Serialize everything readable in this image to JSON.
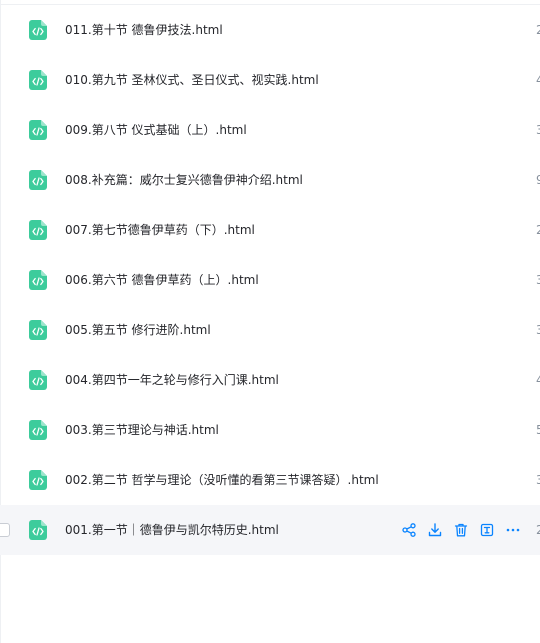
{
  "files": [
    {
      "name": "011.第十节 德鲁伊技法.html",
      "meta": "2"
    },
    {
      "name": "010.第九节 圣林仪式、圣日仪式、视实践.html",
      "meta": "4"
    },
    {
      "name": "009.第八节 仪式基础（上）.html",
      "meta": "3"
    },
    {
      "name": "008.补充篇：威尔士复兴德鲁伊神介绍.html",
      "meta": "9"
    },
    {
      "name": "007.第七节德鲁伊草药（下）.html",
      "meta": "2"
    },
    {
      "name": "006.第六节 德鲁伊草药（上）.html",
      "meta": "3"
    },
    {
      "name": "005.第五节 修行进阶.html",
      "meta": "3"
    },
    {
      "name": "004.第四节一年之轮与修行入门课.html",
      "meta": "4"
    },
    {
      "name": "003.第三节理论与神话.html",
      "meta": "5"
    },
    {
      "name": "002.第二节 哲学与理论（没听懂的看第三节课答疑）.html",
      "meta": "3"
    },
    {
      "name": "001.第一节｜德鲁伊与凯尔特历史.html",
      "meta": "2"
    }
  ],
  "hovered_row_actions": [
    "share-icon",
    "download-icon",
    "delete-icon",
    "rename-icon",
    "more-icon"
  ],
  "colors": {
    "file_icon": "#3dcc9c",
    "action_icon": "#0a84ff",
    "text": "#25262b",
    "meta": "#86909c",
    "hover_bg": "#f5f6f9"
  }
}
